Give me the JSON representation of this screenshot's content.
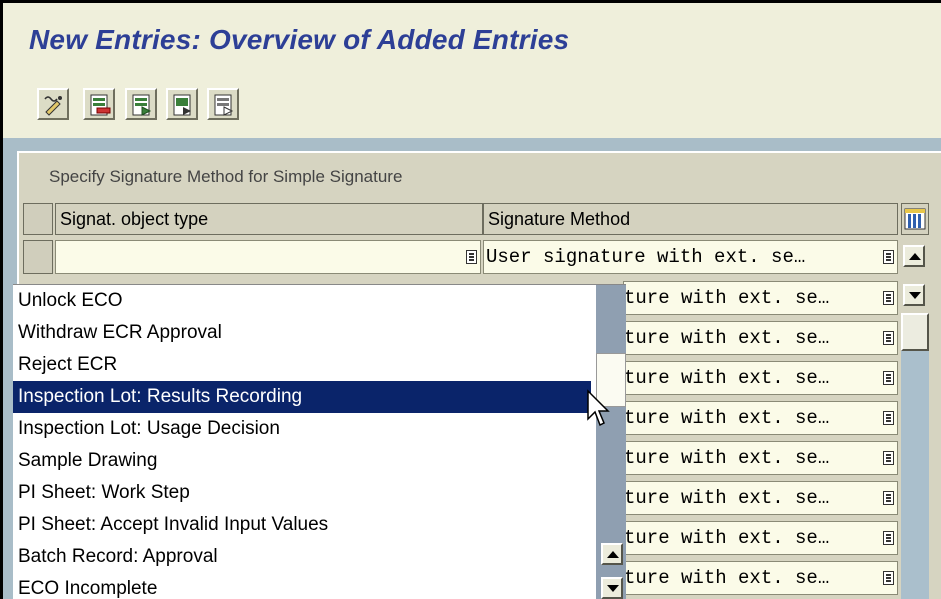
{
  "header": {
    "title": "New Entries: Overview of Added Entries"
  },
  "toolbar": {
    "buttons": [
      {
        "icon": "change-display-icon"
      },
      {
        "icon": "delete-row-icon"
      },
      {
        "icon": "select-all-icon"
      },
      {
        "icon": "select-block-icon"
      },
      {
        "icon": "deselect-all-icon"
      }
    ]
  },
  "table": {
    "title": "Specify Signature Method for Simple Signature",
    "columns": {
      "object_type": "Signat. object type",
      "method": "Signature Method"
    },
    "first_row_method": "User signature with ext. se…",
    "row_methods": [
      "ture with ext. se…",
      "ture with ext. se…",
      "ture with ext. se…",
      "ture with ext. se…",
      "ture with ext. se…",
      "ture with ext. se…",
      "ture with ext. se…",
      "ture with ext. se…"
    ]
  },
  "dropdown": {
    "items": [
      "Unlock ECO",
      "Withdraw ECR Approval",
      "Reject ECR",
      "Inspection Lot: Results Recording",
      "Inspection Lot: Usage Decision",
      "Sample Drawing",
      "PI Sheet: Work Step",
      "PI Sheet: Accept Invalid Input Values",
      "Batch Record: Approval",
      "ECO Incomplete"
    ],
    "selected_index": 3
  },
  "colors": {
    "title": "#2d3f96",
    "selection": "#0a246a",
    "background": "#d4d0c8"
  }
}
